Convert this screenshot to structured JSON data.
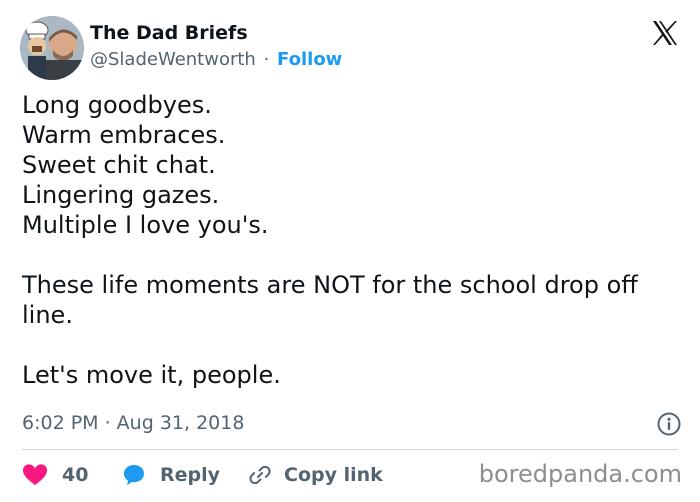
{
  "author": {
    "display_name": "The Dad Briefs",
    "handle": "@SladeWentworth",
    "separator": "·",
    "follow_label": "Follow"
  },
  "tweet": {
    "paragraphs": [
      "Long goodbyes.\nWarm embraces.\nSweet chit chat.\nLingering gazes.\nMultiple I love you's.",
      "These life moments are NOT for the school drop off line.",
      "Let's move it, people."
    ],
    "timestamp": "6:02 PM · Aug 31, 2018"
  },
  "actions": {
    "like_count": "40",
    "reply_label": "Reply",
    "copy_link_label": "Copy link"
  },
  "watermark": "boredpanda.com",
  "icons": {
    "brand": "x-logo-icon",
    "info": "info-icon",
    "like": "heart-icon",
    "reply": "speech-bubble-icon",
    "copy": "link-icon"
  },
  "colors": {
    "text": "#0f1419",
    "secondary": "#536471",
    "accent": "#1d9bf0",
    "heart": "#f91880",
    "divider": "#cfd9de"
  }
}
